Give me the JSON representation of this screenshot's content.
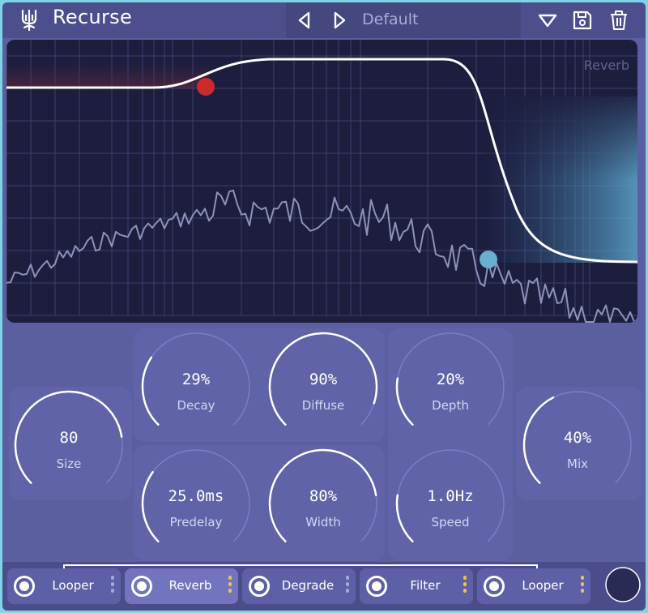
{
  "header": {
    "title": "Recurse",
    "preset_name": "Default",
    "icons": [
      "logo-icon",
      "prev-preset-icon",
      "next-preset-icon",
      "preset-menu-icon",
      "save-icon",
      "delete-icon"
    ]
  },
  "graph": {
    "label": "Reverb"
  },
  "knobs": {
    "size": {
      "value": "80",
      "label": "Size",
      "level": 0.8
    },
    "decay": {
      "value": "29%",
      "label": "Decay",
      "level": 0.29
    },
    "diffuse": {
      "value": "90%",
      "label": "Diffuse",
      "level": 0.9
    },
    "depth": {
      "value": "20%",
      "label": "Depth",
      "level": 0.2
    },
    "mix": {
      "value": "40%",
      "label": "Mix",
      "level": 0.4
    },
    "predelay": {
      "value": "25.0ms",
      "label": "Predelay",
      "level": 0.3
    },
    "width": {
      "value": "80%",
      "label": "Width",
      "level": 0.8
    },
    "speed": {
      "value": "1.0Hz",
      "label": "Speed",
      "level": 0.2
    }
  },
  "chain": {
    "modules": [
      {
        "name": "Looper",
        "active": false,
        "dots": "gray"
      },
      {
        "name": "Reverb",
        "active": true,
        "dots": "yellow"
      },
      {
        "name": "Degrade",
        "active": false,
        "dots": "gray"
      },
      {
        "name": "Filter",
        "active": false,
        "dots": "yellow"
      },
      {
        "name": "Looper",
        "active": false,
        "dots": "yellow"
      }
    ]
  },
  "colors": {
    "background": "#5b5e9f",
    "header": "#4d4f8c",
    "graph_bg": "#1d1e3e",
    "low_handle": "#cc2a2a",
    "high_handle": "#6aaed0",
    "accent_dots": "#f0c240"
  }
}
